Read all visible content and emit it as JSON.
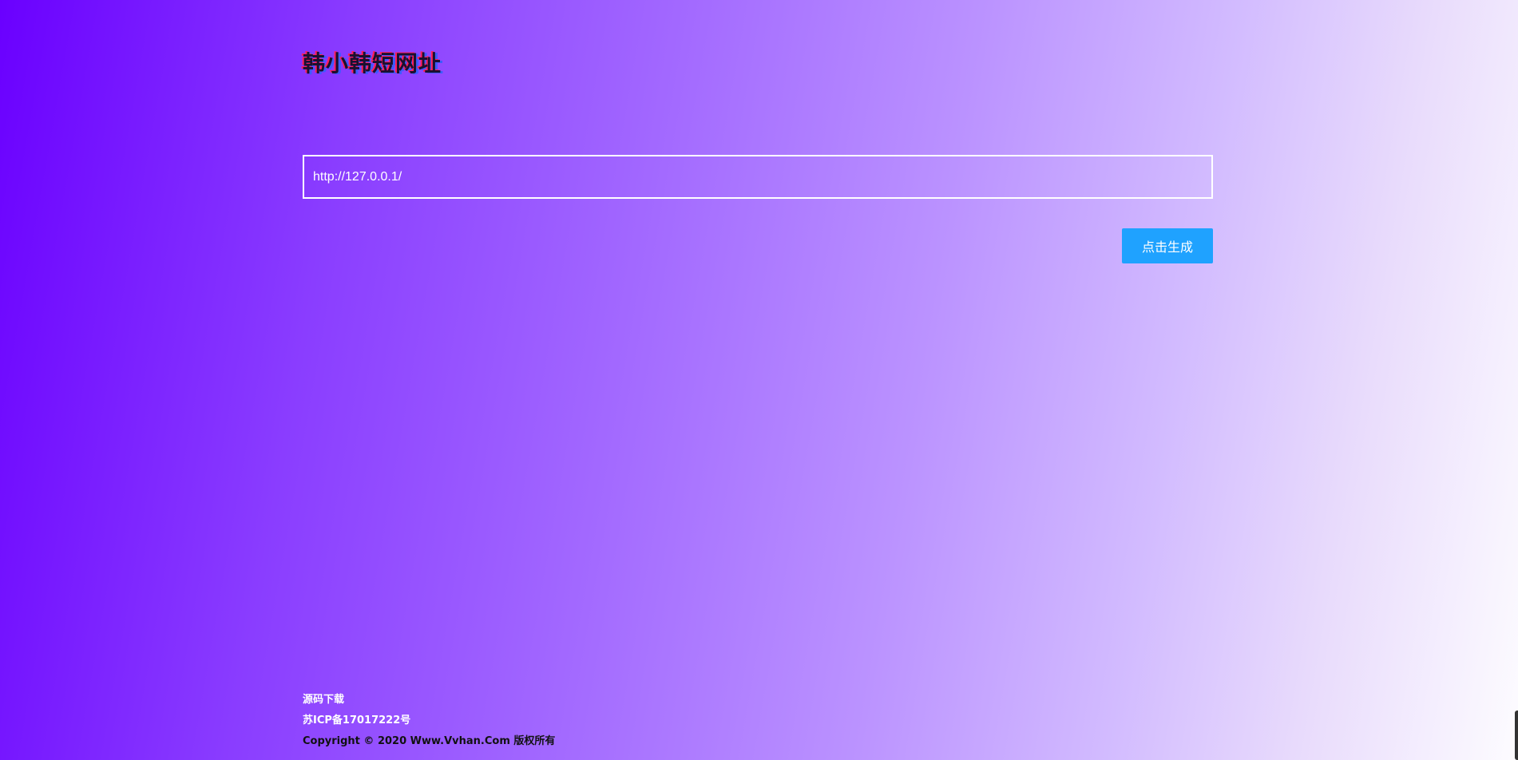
{
  "header": {
    "logo_text": "韩小韩短网址"
  },
  "form": {
    "url_value": "http://127.0.0.1/",
    "submit_label": "点击生成",
    "submit_color": "#1fa2ff"
  },
  "footer": {
    "source_link": "源码下载",
    "icp_link": "苏ICP备17017222号",
    "copyright": "Copyright © 2020 Www.Vvhan.Com 版权所有"
  },
  "theme": {
    "gradient_start": "#6a00ff",
    "gradient_end": "#fdfcff"
  }
}
